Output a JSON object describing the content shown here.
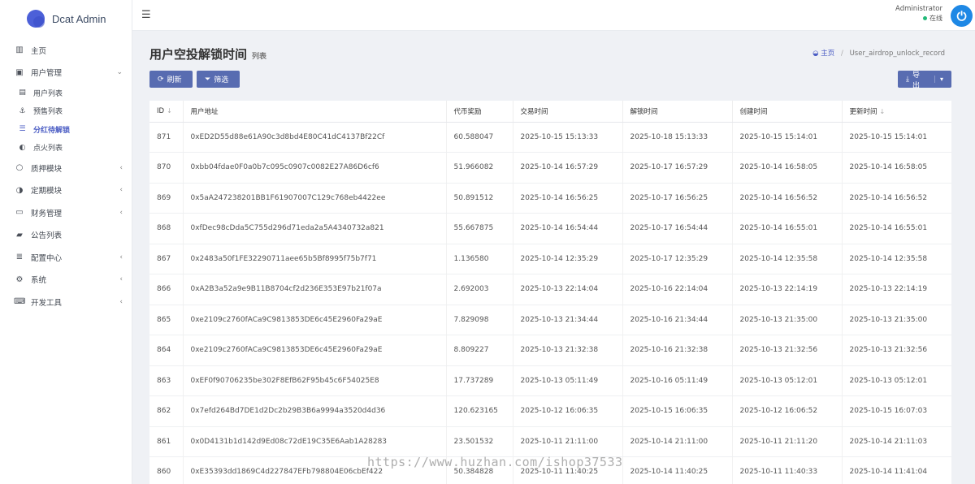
{
  "brand": {
    "name": "Dcat Admin"
  },
  "sidebar": {
    "items": [
      {
        "icon": "bar-chart-icon",
        "label": "主页"
      },
      {
        "icon": "user-card-icon",
        "label": "用户管理",
        "expanded": true,
        "children": [
          {
            "icon": "user-list-icon",
            "label": "用户列表"
          },
          {
            "icon": "anchor-icon",
            "label": "预售列表"
          },
          {
            "icon": "list-icon",
            "label": "分红待解锁",
            "active": true
          },
          {
            "icon": "fire-icon",
            "label": "点火列表"
          }
        ]
      },
      {
        "icon": "circle-icon",
        "label": "质押模块"
      },
      {
        "icon": "half-circle-icon",
        "label": "定期模块"
      },
      {
        "icon": "money-icon",
        "label": "财务管理"
      },
      {
        "icon": "book-icon",
        "label": "公告列表"
      },
      {
        "icon": "menu-icon",
        "label": "配置中心"
      },
      {
        "icon": "gear-icon",
        "label": "系统"
      },
      {
        "icon": "keyboard-icon",
        "label": "开发工具"
      }
    ]
  },
  "topbar": {
    "user_name": "Administrator",
    "user_status": "在线"
  },
  "page": {
    "title": "用户空投解锁时间",
    "subtitle": "列表",
    "breadcrumb": {
      "home": "主页",
      "current": "User_airdrop_unlock_record"
    }
  },
  "toolbar": {
    "refresh_label": "刷新",
    "filter_label": "筛选",
    "export_label": "导出"
  },
  "table": {
    "columns": [
      "ID",
      "用户地址",
      "代币奖励",
      "交易时间",
      "解锁时间",
      "创建时间",
      "更新时间"
    ],
    "rows": [
      [
        "871",
        "0xED2D55d88e61A90c3d8bd4E80C41dC4137Bf22Cf",
        "60.588047",
        "2025-10-15 15:13:33",
        "2025-10-18 15:13:33",
        "2025-10-15 15:14:01",
        "2025-10-15 15:14:01"
      ],
      [
        "870",
        "0xbb04fdae0F0a0b7c095c0907c0082E27A86D6cf6",
        "51.966082",
        "2025-10-14 16:57:29",
        "2025-10-17 16:57:29",
        "2025-10-14 16:58:05",
        "2025-10-14 16:58:05"
      ],
      [
        "869",
        "0x5aA247238201BB1F61907007C129c768eb4422ee",
        "50.891512",
        "2025-10-14 16:56:25",
        "2025-10-17 16:56:25",
        "2025-10-14 16:56:52",
        "2025-10-14 16:56:52"
      ],
      [
        "868",
        "0xfDec98cDda5C755d296d71eda2a5A4340732a821",
        "55.667875",
        "2025-10-14 16:54:44",
        "2025-10-17 16:54:44",
        "2025-10-14 16:55:01",
        "2025-10-14 16:55:01"
      ],
      [
        "867",
        "0x2483a50f1FE32290711aee65b5Bf8995f75b7f71",
        "1.136580",
        "2025-10-14 12:35:29",
        "2025-10-17 12:35:29",
        "2025-10-14 12:35:58",
        "2025-10-14 12:35:58"
      ],
      [
        "866",
        "0xA2B3a52a9e9B11B8704cf2d236E353E97b21f07a",
        "2.692003",
        "2025-10-13 22:14:04",
        "2025-10-16 22:14:04",
        "2025-10-13 22:14:19",
        "2025-10-13 22:14:19"
      ],
      [
        "865",
        "0xe2109c2760fACa9C9813853DE6c45E2960Fa29aE",
        "7.829098",
        "2025-10-13 21:34:44",
        "2025-10-16 21:34:44",
        "2025-10-13 21:35:00",
        "2025-10-13 21:35:00"
      ],
      [
        "864",
        "0xe2109c2760fACa9C9813853DE6c45E2960Fa29aE",
        "8.809227",
        "2025-10-13 21:32:38",
        "2025-10-16 21:32:38",
        "2025-10-13 21:32:56",
        "2025-10-13 21:32:56"
      ],
      [
        "863",
        "0xEF0f90706235be302F8EfB62F95b45c6F54025E8",
        "17.737289",
        "2025-10-13 05:11:49",
        "2025-10-16 05:11:49",
        "2025-10-13 05:12:01",
        "2025-10-13 05:12:01"
      ],
      [
        "862",
        "0x7efd264Bd7DE1d2Dc2b29B3B6a9994a3520d4d36",
        "120.623165",
        "2025-10-12 16:06:35",
        "2025-10-15 16:06:35",
        "2025-10-12 16:06:52",
        "2025-10-15 16:07:03"
      ],
      [
        "861",
        "0x0D4131b1d142d9Ed08c72dE19C35E6Aab1A28283",
        "23.501532",
        "2025-10-11 21:11:00",
        "2025-10-14 21:11:00",
        "2025-10-11 21:11:20",
        "2025-10-14 21:11:03"
      ],
      [
        "860",
        "0xE35393dd1869C4d227847EFb798804E06cbEf422",
        "50.384828",
        "2025-10-11 11:40:25",
        "2025-10-14 11:40:25",
        "2025-10-11 11:40:33",
        "2025-10-14 11:41:04"
      ]
    ]
  },
  "watermark": "https://www.huzhan.com/ishop37533"
}
